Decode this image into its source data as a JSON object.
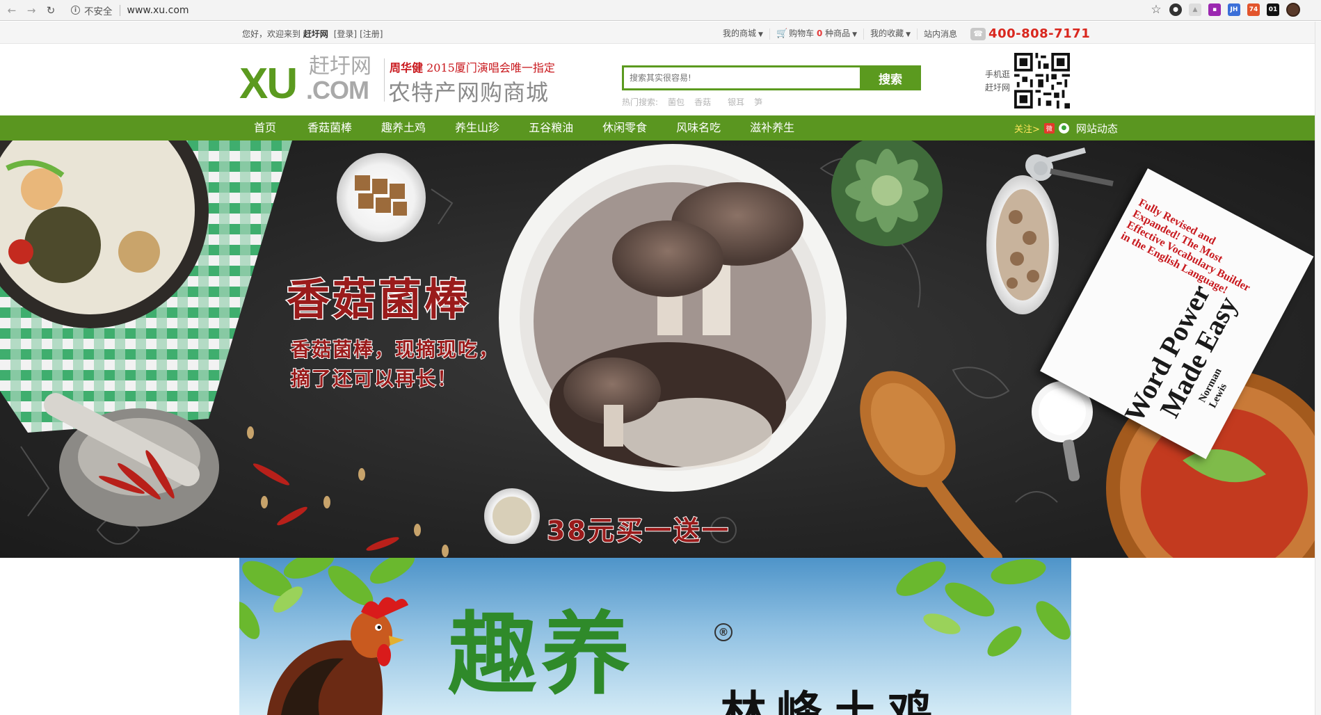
{
  "browser": {
    "security_label": "不安全",
    "url": "www.xu.com",
    "extensions": [
      "JH",
      "74",
      "01"
    ]
  },
  "topbar": {
    "welcome_prefix": "您好，欢迎来到",
    "site_name": "赶圩网",
    "login": "[登录]",
    "register": "[注册]",
    "my_mall": "我的商城",
    "cart_prefix": "购物车",
    "cart_count": "0",
    "cart_suffix": "种商品",
    "favorites": "我的收藏",
    "messages": "站内消息",
    "hotline": "400-808-7171"
  },
  "header": {
    "logo_latin": "XU",
    "logo_cn": "赶圩网",
    "logo_domain": ".COM",
    "slogan_top_name": "周华健",
    "slogan_top_rest": "2015厦门演唱会唯一指定",
    "slogan_main": "农特产网购商城",
    "search_placeholder": "搜索其实很容易!",
    "search_button": "搜索",
    "hot_label": "热门搜索:",
    "hot_terms": [
      "菌包",
      "香菇",
      "银耳",
      "笋"
    ],
    "qr_label_line1": "手机逛",
    "qr_label_line2": "赶圩网"
  },
  "nav": {
    "items": [
      "首页",
      "香菇菌棒",
      "趣养土鸡",
      "养生山珍",
      "五谷粮油",
      "休闲零食",
      "风味名吃",
      "滋补养生"
    ],
    "follow_label": "关注>",
    "site_news": "网站动态"
  },
  "hero": {
    "title": "香菇菌棒",
    "sub_line1": "香菇菌棒，现摘现吃，",
    "sub_line2": "摘了还可以再长！",
    "promo": "38元买一送一",
    "book_tagline": "Fully Revised and Expanded! The Most Effective Vocabulary Builder in the English Language!",
    "book_title_line1": "Word Power",
    "book_title_line2": "Made Easy",
    "book_author": "Norman Lewis"
  },
  "banner2": {
    "brand": "趣养",
    "reg_mark": "®",
    "subtitle": "林峰土鸡"
  },
  "colors": {
    "brand_green": "#5a9620",
    "hotline_red": "#d9271e",
    "title_red": "#9a1b1b"
  }
}
